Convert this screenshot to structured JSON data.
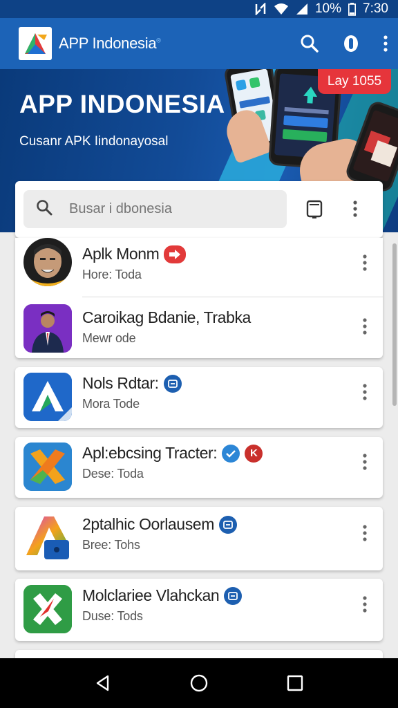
{
  "status_bar": {
    "battery": "10%",
    "time": "7:30"
  },
  "app_bar": {
    "title": "APP Indonesia",
    "title_mark": "®"
  },
  "hero": {
    "title": "APP INDONESIA",
    "subtitle": "Cusanr APK Iindonayosal",
    "badge": "Lay 1055"
  },
  "search": {
    "placeholder": "Busar i dbonesia"
  },
  "apps": [
    {
      "name": "Aplk Monm",
      "meta": "Hore: Toda",
      "icon": "face-avatar-icon",
      "badges": [
        "red-arrow-badge"
      ]
    },
    {
      "name": "Caroikag Bdanie, Trabka",
      "meta": "Mewr ode",
      "icon": "news-anchor-icon",
      "badges": []
    },
    {
      "name": "Nols Rdtar:",
      "meta": "Mora Tode",
      "icon": "blue-a-logo-icon",
      "badges": [
        "blue-square-badge"
      ]
    },
    {
      "name": "Apl:ebcsing Tracter:",
      "meta": "Dese: Toda",
      "icon": "orange-x-logo-icon",
      "badges": [
        "blue-check-badge",
        "red-k-badge"
      ]
    },
    {
      "name": "2ptalhic Oorlausem",
      "meta": "Bree: Tohs",
      "icon": "gradient-a-logo-icon",
      "badges": [
        "blue-square-badge"
      ]
    },
    {
      "name": "Molclariee Vlahckan",
      "meta": "Duse: Tods",
      "icon": "green-x-logo-icon",
      "badges": [
        "blue-square-badge"
      ]
    }
  ],
  "colors": {
    "app_bar": "#1c63b7",
    "status_bar": "#0e4286",
    "hero_badge": "#e6353b",
    "background": "#ececec"
  }
}
